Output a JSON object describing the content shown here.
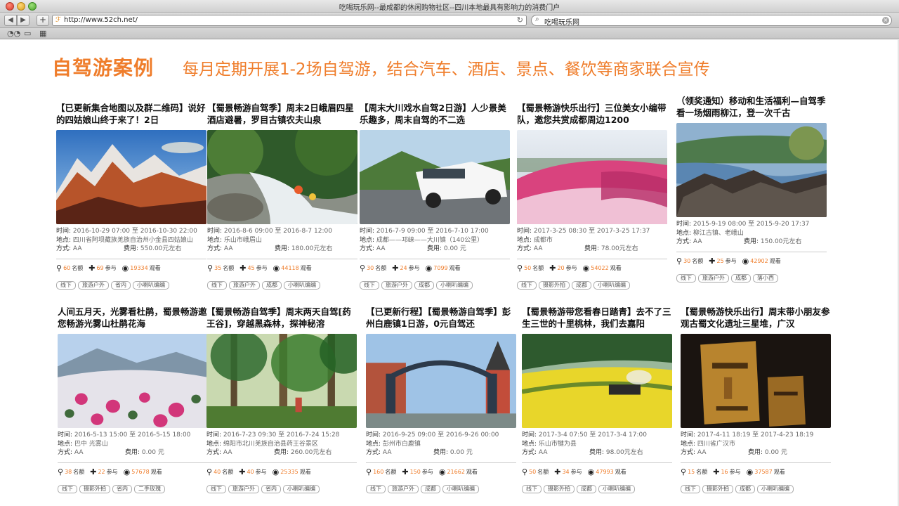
{
  "window": {
    "title": "吃喝玩乐网--最成都的休闲购物社区--四川本地最具有影响力的消费门户",
    "url": "http://www.52ch.net/",
    "search_value": "吃喝玩乐网"
  },
  "page": {
    "title": "自驾游案例",
    "subtitle": "每月定期开展1-2场自驾游，结合汽车、酒店、景点、餐饮等商家联合宣传",
    "accent_color": "#ef7d2b"
  },
  "labels": {
    "time": "时间:",
    "place": "地点:",
    "mode": "方式:",
    "fee": "费用:",
    "quota": "名额",
    "join": "参与",
    "view": "观看"
  },
  "cards": [
    {
      "title": "【已更新集合地图以及群二维码】说好的四姑娘山终于来了！2日",
      "time": "2016-10-29 07:00 至 2016-10-30 22:00",
      "place": "四川省阿坝藏族羌族自治州小金县四姑娘山",
      "mode": "AA",
      "fee": "550.00元左右",
      "quota": "60",
      "join": "69",
      "views": "19334",
      "tags": [
        "线下",
        "旅游户外",
        "省内",
        "小喇叭编编"
      ]
    },
    {
      "title": "【蜀景畅游自驾季】周末2日峨眉四星酒店避暑，罗目古镇农夫山泉",
      "time": "2016-8-6 09:00 至 2016-8-7 12:00",
      "place": "乐山市峨眉山",
      "mode": "AA",
      "fee": "180.00元左右",
      "quota": "35",
      "join": "45",
      "views": "44118",
      "tags": [
        "线下",
        "旅游户外",
        "成都",
        "小喇叭编编"
      ]
    },
    {
      "title": "【周末大川戏水自驾2日游】人少景美乐趣多，周末自驾的不二选",
      "time": "2016-7-9 09:00 至 2016-7-10 17:00",
      "place": "成都——邛崃——大川镇（140公里）",
      "mode": "AA",
      "fee": "0.00 元",
      "quota": "30",
      "join": "24",
      "views": "7099",
      "tags": [
        "线下",
        "旅游户外",
        "成都",
        "小喇叭编编"
      ]
    },
    {
      "title": "【蜀景畅游快乐出行】三位美女小编带队，邀您共赏成都周边1200",
      "time": "2017-3-25 08:30 至 2017-3-25 17:37",
      "place": "成都市",
      "mode": "AA",
      "fee": "78.00元左右",
      "quota": "50",
      "join": "20",
      "views": "54022",
      "tags": [
        "线下",
        "摄影外拍",
        "成都",
        "小喇叭编编"
      ]
    },
    {
      "title": "（领奖通知）移动和生活福利—自驾季看一场烟雨柳江，登一次千古",
      "time": "2015-9-19 08:00 至 2015-9-20 17:37",
      "place": "柳江古镇、老峨山",
      "mode": "AA",
      "fee": "150.00元左右",
      "quota": "30",
      "join": "25",
      "views": "42902",
      "tags": [
        "线下",
        "旅游户外",
        "成都",
        "落小西"
      ]
    },
    {
      "title": "人间五月天，光雾看杜鹃，蜀景畅游邀您畅游光雾山杜鹃花海",
      "time": "2016-5-13 15:00 至 2016-5-15 18:00",
      "place": "巴中 光雾山",
      "mode": "AA",
      "fee": "0.00 元",
      "quota": "38",
      "join": "22",
      "views": "57678",
      "tags": [
        "线下",
        "摄影外拍",
        "省内",
        "二手玫瑰"
      ]
    },
    {
      "title": "【蜀景畅游自驾季】周末两天自驾[药王谷]，穿越黑森林，探神秘溶",
      "time": "2016-7-23 09:30 至 2016-7-24 15:28",
      "place": "绵阳市北川羌族自治县药王谷景区",
      "mode": "AA",
      "fee": "260.00元左右",
      "quota": "40",
      "join": "40",
      "views": "25335",
      "tags": [
        "线下",
        "旅游户外",
        "省内",
        "小喇叭编编"
      ]
    },
    {
      "title": "【已更新行程】【蜀景畅游自驾季】彭州白鹿镇1日游，0元自驾还",
      "time": "2016-9-25 09:00 至 2016-9-26 00:00",
      "place": "彭州市白鹿镇",
      "mode": "AA",
      "fee": "0.00 元",
      "quota": "160",
      "join": "150",
      "views": "21662",
      "tags": [
        "线下",
        "旅游户外",
        "成都",
        "小喇叭编编"
      ]
    },
    {
      "title": "【蜀景畅游带您看春日踏青】去不了三生三世的十里桃林，我们去嘉阳",
      "time": "2017-3-4 07:50 至 2017-3-4 17:00",
      "place": "乐山市犍为县",
      "mode": "AA",
      "fee": "98.00元左右",
      "quota": "50",
      "join": "34",
      "views": "47993",
      "tags": [
        "线下",
        "摄影外拍",
        "成都",
        "小喇叭编编"
      ]
    },
    {
      "title": "【蜀景畅游快乐出行】周末带小朋友参观古蜀文化遗址三星堆，广汉",
      "time": "2017-4-11 18:19 至 2017-4-23 18:19",
      "place": "四川省广汉市",
      "mode": "AA",
      "fee": "0.00 元",
      "quota": "15",
      "join": "16",
      "views": "37587",
      "tags": [
        "线下",
        "摄影外拍",
        "成都",
        "小喇叭编编"
      ]
    }
  ]
}
